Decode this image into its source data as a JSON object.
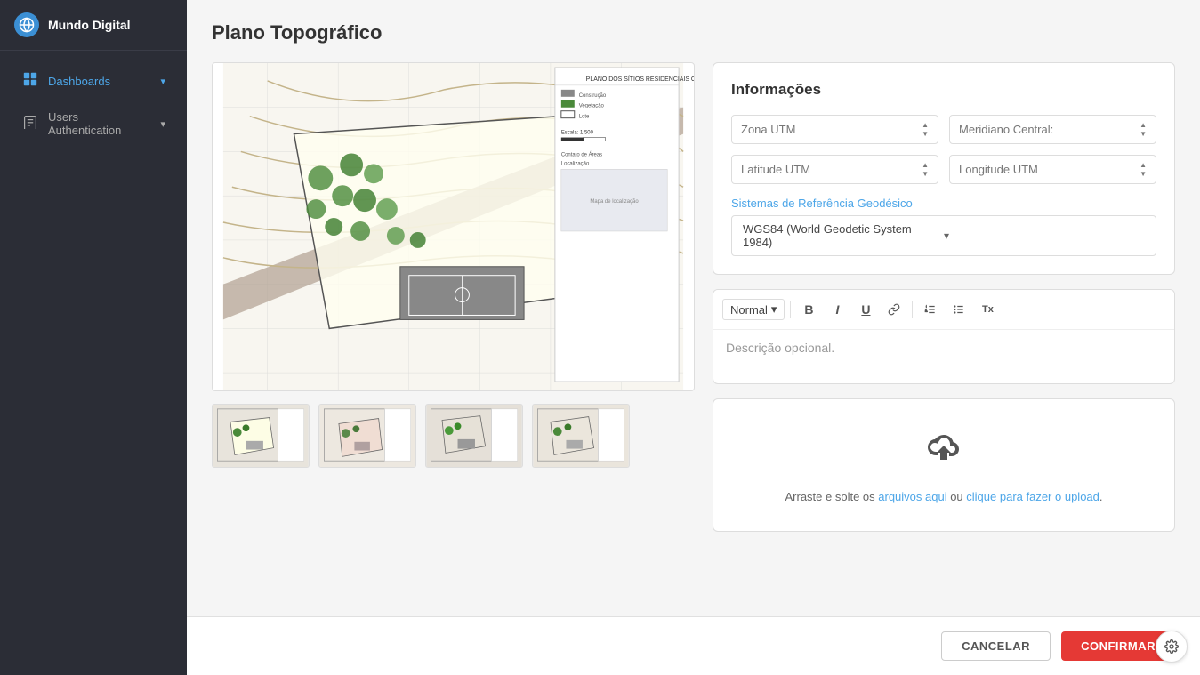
{
  "app": {
    "name": "Mundo Digital"
  },
  "sidebar": {
    "logo_icon": "🌐",
    "items": [
      {
        "id": "dashboards",
        "label": "Dashboards",
        "icon": "⊞",
        "active": true,
        "has_arrow": true
      },
      {
        "id": "users-auth",
        "label": "Users Authentication",
        "icon": "📋",
        "active": false,
        "has_arrow": true
      }
    ]
  },
  "page": {
    "title": "Plano Topográfico"
  },
  "info_panel": {
    "title": "Informações",
    "fields": [
      {
        "id": "zona-utm",
        "label": "Zona UTM",
        "value": ""
      },
      {
        "id": "meridiano-central",
        "label": "Meridiano Central:",
        "value": ""
      },
      {
        "id": "latitude-utm",
        "label": "Latitude UTM",
        "value": ""
      },
      {
        "id": "longitude-utm",
        "label": "Longitude UTM",
        "value": ""
      }
    ],
    "geodesic_label": "Sistemas de Referência Geodésico",
    "geodesic_value": "WGS84 (World Geodetic System 1984)"
  },
  "editor": {
    "format_label": "Normal",
    "format_arrow": "▼",
    "placeholder": "Descrição opcional.",
    "toolbar": {
      "bold": "B",
      "italic": "I",
      "underline": "U",
      "link": "🔗",
      "ol": "≡",
      "ul": "≡",
      "clear": "Tx"
    }
  },
  "upload": {
    "text_before": "Arraste e solte os ",
    "text_link": "arquivos aqui",
    "text_middle": " ou ",
    "text_link2": "clique para fazer o upload",
    "text_after": "."
  },
  "actions": {
    "cancel_label": "CANCELAR",
    "confirm_label": "CONFIRMAR"
  },
  "thumbnails": [
    {
      "id": 1
    },
    {
      "id": 2
    },
    {
      "id": 3
    },
    {
      "id": 4
    }
  ]
}
